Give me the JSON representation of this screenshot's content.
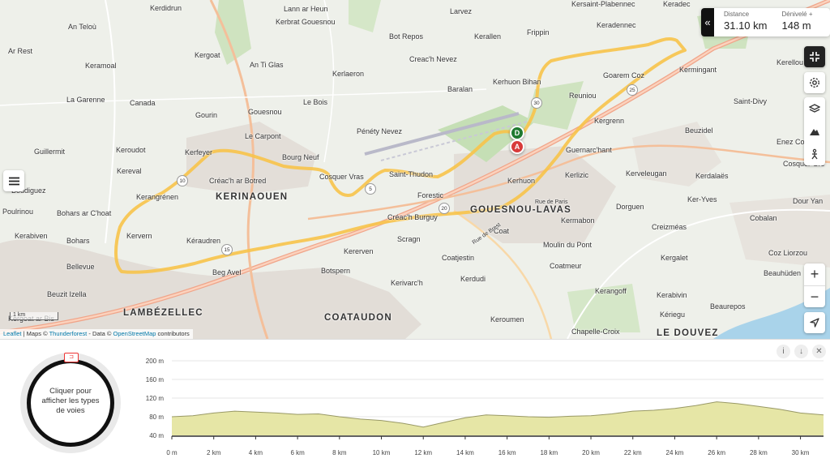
{
  "stats": {
    "collapse_icon": "double-chevron-left",
    "distance_label": "Distance",
    "distance_value": "31.10 km",
    "elevation_label": "Dénivelé +",
    "elevation_value": "148 m"
  },
  "map": {
    "places": [
      "Kerdidrun",
      "Lann ar Heun",
      "Larvez",
      "Kersaint-Plabennec",
      "Keradec",
      "An Teloù",
      "Kerbrat Gouesnou",
      "Bot Repos",
      "Kerallen",
      "Frippin",
      "Keradennec",
      "Ar Rest",
      "Kergoat",
      "Creac'h Nevez",
      "Keramoal",
      "An Ti Glas",
      "Kerlaeron",
      "Baralan",
      "Kerhuon Bihan",
      "Goarem Coz",
      "Kermingant",
      "Kerellou",
      "La Garenne",
      "Canada",
      "Gouesnou",
      "Le Bois",
      "Reuniou",
      "Saint-Divy",
      "Gourin",
      "Le Carpont",
      "Pénéty Nevez",
      "Kergrenn",
      "Beuzidel",
      "Guillermit",
      "Keroudot",
      "Kerfeyer",
      "Bourg Neuf",
      "Guernarc'hant",
      "Enez Coz",
      "Kereval",
      "Créac'h ar Botred",
      "Cosquer Vras",
      "Saint-Thudon",
      "Kerlizic",
      "Kerveleugan",
      "Kerdalaës",
      "Cosquer Gre",
      "Boudiguez",
      "Kerangrénen",
      "Forestic",
      "Kerhuon",
      "Ker-Yves",
      "Dour Yan",
      "Poulrinou",
      "Bohars ar C'hoat",
      "Créac'h Burguy",
      "Dorguen",
      "Kermabon",
      "Creizméas",
      "Cobalan",
      "Kerabiven",
      "Kervern",
      "Kéraudren",
      "Scragn",
      "Coat",
      "Moulin du Pont",
      "Kergalet",
      "Bohars",
      "Kererven",
      "Coz Liorzou",
      "Bellevue",
      "Coatjestin",
      "Coatmeur",
      "Beuzit Izella",
      "Beg Avel",
      "Botspern",
      "Kerdudi",
      "Beauhüden",
      "Kerivarc'h",
      "Kerangoff",
      "Kerabivin",
      "Kériegu",
      "Beaurepos",
      "Keroumen",
      "Chapelle-Croix",
      "Rue de Paris",
      "Rue de Brest",
      "Kergoat ar Bis"
    ],
    "towns": [
      "KERINAOUEN",
      "LAMBÉZELLEC",
      "COATAUDON",
      "GOUESNOU-LAVAS",
      "LE DOUVEZ"
    ],
    "marker_start": "D",
    "marker_end": "A",
    "km_markers": [
      "5",
      "10",
      "15",
      "20",
      "25",
      "30"
    ],
    "scale_label": "1 km",
    "attribution": {
      "leaflet": "Leaflet",
      "maps": "| Maps ©",
      "thunderforest": "Thunderforest",
      "data": "- Data ©",
      "osm": "OpenStreetMap",
      "contrib": "contributors"
    },
    "controls": [
      "collapse-fullscreen-icon",
      "settings-icon",
      "layers-icon",
      "mountain-icon",
      "hiker-icon"
    ],
    "zoom_in": "+",
    "zoom_out": "−",
    "menu_icon": "hamburger-icon",
    "locate_icon": "navigation-arrow-icon"
  },
  "panel": {
    "donut_text": "Cliquer pour afficher les types de voies",
    "donut_tag": "⊐",
    "buttons": [
      "info-icon",
      "download-icon",
      "close-icon"
    ]
  },
  "chart_data": {
    "type": "area",
    "title": "",
    "xlabel": "",
    "ylabel": "",
    "xlim": [
      0,
      31.1
    ],
    "ylim": [
      40,
      200
    ],
    "y_ticks": [
      "200 m",
      "160 m",
      "120 m",
      "80 m",
      "40 m"
    ],
    "x_ticks": [
      "0 m",
      "2 km",
      "4 km",
      "6 km",
      "8 km",
      "10 km",
      "12 km",
      "14 km",
      "16 km",
      "18 km",
      "20 km",
      "22 km",
      "24 km",
      "26 km",
      "28 km",
      "30 km"
    ],
    "x": [
      0,
      1,
      2,
      3,
      4,
      5,
      6,
      7,
      8,
      9,
      10,
      11,
      12,
      13,
      14,
      15,
      16,
      17,
      18,
      19,
      20,
      21,
      22,
      23,
      24,
      25,
      26,
      27,
      28,
      29,
      30,
      31.1
    ],
    "y": [
      80,
      82,
      88,
      92,
      90,
      88,
      85,
      86,
      80,
      75,
      72,
      66,
      58,
      68,
      78,
      84,
      82,
      80,
      79,
      81,
      82,
      86,
      92,
      94,
      98,
      104,
      112,
      108,
      102,
      96,
      88,
      84
    ],
    "fill_color": "#e6e6a6",
    "line_color": "#999966"
  }
}
